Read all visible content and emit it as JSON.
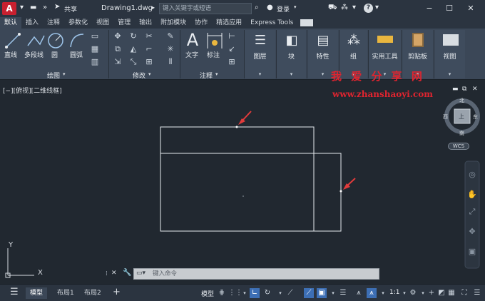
{
  "titlebar": {
    "logo": "A",
    "share": "共享",
    "document": "Drawing1.dwg",
    "search_placeholder": "键入关键字或短语",
    "login": "登录",
    "help": "?"
  },
  "tabs": [
    "默认",
    "插入",
    "注释",
    "参数化",
    "视图",
    "管理",
    "输出",
    "附加模块",
    "协作",
    "精选应用",
    "Express Tools"
  ],
  "ribbon": {
    "draw": {
      "title": "绘图",
      "line": "直线",
      "polyline": "多段线",
      "circle": "圆",
      "arc": "圆弧"
    },
    "modify": {
      "title": "修改"
    },
    "annotation": {
      "title": "注释",
      "text": "文字",
      "dimension": "标注"
    },
    "big_buttons": [
      "图层",
      "块",
      "特性",
      "组",
      "实用工具",
      "剪贴板",
      "视图"
    ]
  },
  "viewport": {
    "label": "[−][俯视][二维线框]",
    "watermark_cn": "我 爱 分 享 网",
    "watermark_url": "www.zhanshaoyi.com",
    "viewcube": {
      "north": "北",
      "south": "南",
      "east": "东",
      "west": "西",
      "top": "上"
    },
    "wcs": "WCS",
    "ucs_x": "X",
    "ucs_y": "Y"
  },
  "command": {
    "placeholder": "键入命令"
  },
  "statusbar": {
    "tabs": [
      "模型",
      "布局1",
      "布局2"
    ],
    "model": "模型",
    "scale": "1:1"
  },
  "colors": {
    "accent": "#3d6fb5",
    "background": "#212830",
    "watermark": "#e0242f",
    "arrow": "#e23b3b"
  }
}
